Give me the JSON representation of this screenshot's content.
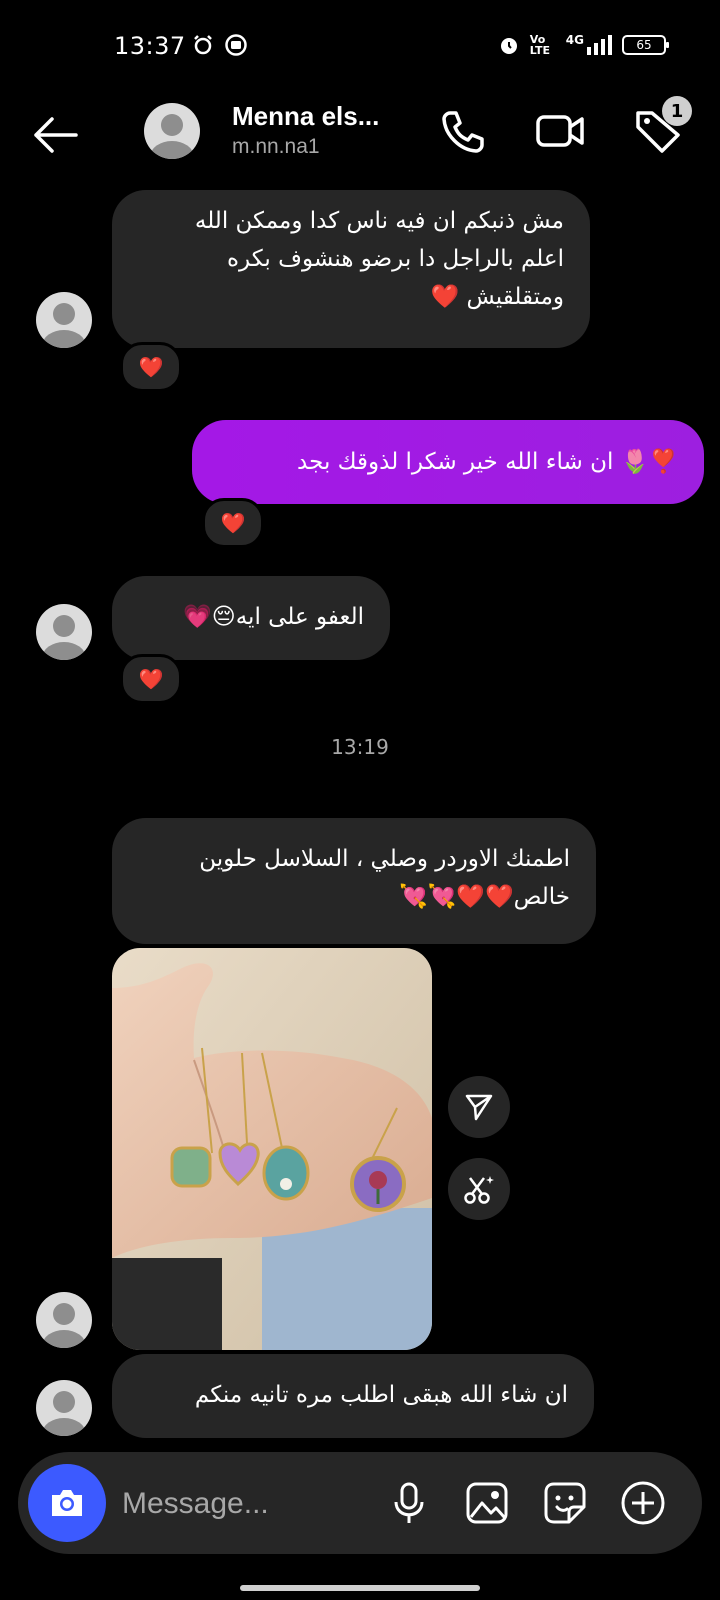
{
  "status_bar": {
    "time": "13:37",
    "network": "4G",
    "volte": "Vo LTE",
    "battery": "65"
  },
  "header": {
    "name": "Menna els...",
    "handle": "m.nn.na1",
    "badge_count": "1"
  },
  "messages": [
    {
      "direction": "incoming",
      "lines": [
        "مش ذنبكم ان فيه ناس كدا وممكن الله",
        "اعلم بالراجل دا برضو هنشوف بكره",
        "ومتقلقيش ❤️"
      ],
      "reaction": "❤️"
    },
    {
      "direction": "outgoing",
      "lines": [
        "❣️🌷 ان شاء الله خير شكرا لذوقك بجد"
      ],
      "reaction": "❤️"
    },
    {
      "direction": "incoming",
      "lines": [
        "العفو على ايه😔💗"
      ],
      "reaction": "❤️"
    },
    {
      "direction": "incoming",
      "lines": [
        "اطمنك الاوردر وصلي ، السلاسل حلوين",
        "خالص❤️❤️💘💘"
      ]
    },
    {
      "direction": "incoming",
      "type": "photo",
      "alt": "photo of four pendant necklaces held in a hand"
    },
    {
      "direction": "incoming",
      "lines": [
        "ان شاء الله هبقى اطلب مره تانيه منكم"
      ]
    }
  ],
  "timestamp_divider": "13:19",
  "composer": {
    "placeholder": "Message..."
  },
  "icons": {
    "back": "back-arrow-icon",
    "call": "phone-icon",
    "video": "video-camera-icon",
    "tag": "tag-icon",
    "share": "send-icon",
    "edit": "scissors-sparkle-icon",
    "camera": "camera-icon",
    "mic": "microphone-icon",
    "gallery": "image-icon",
    "sticker": "sticker-icon",
    "add": "plus-circle-icon"
  },
  "colors": {
    "background": "#000000",
    "incoming_bubble": "#262626",
    "outgoing_bubble": "#a418e6",
    "camera_button": "#3c5aff",
    "reaction_heart": "#ff2d55"
  }
}
